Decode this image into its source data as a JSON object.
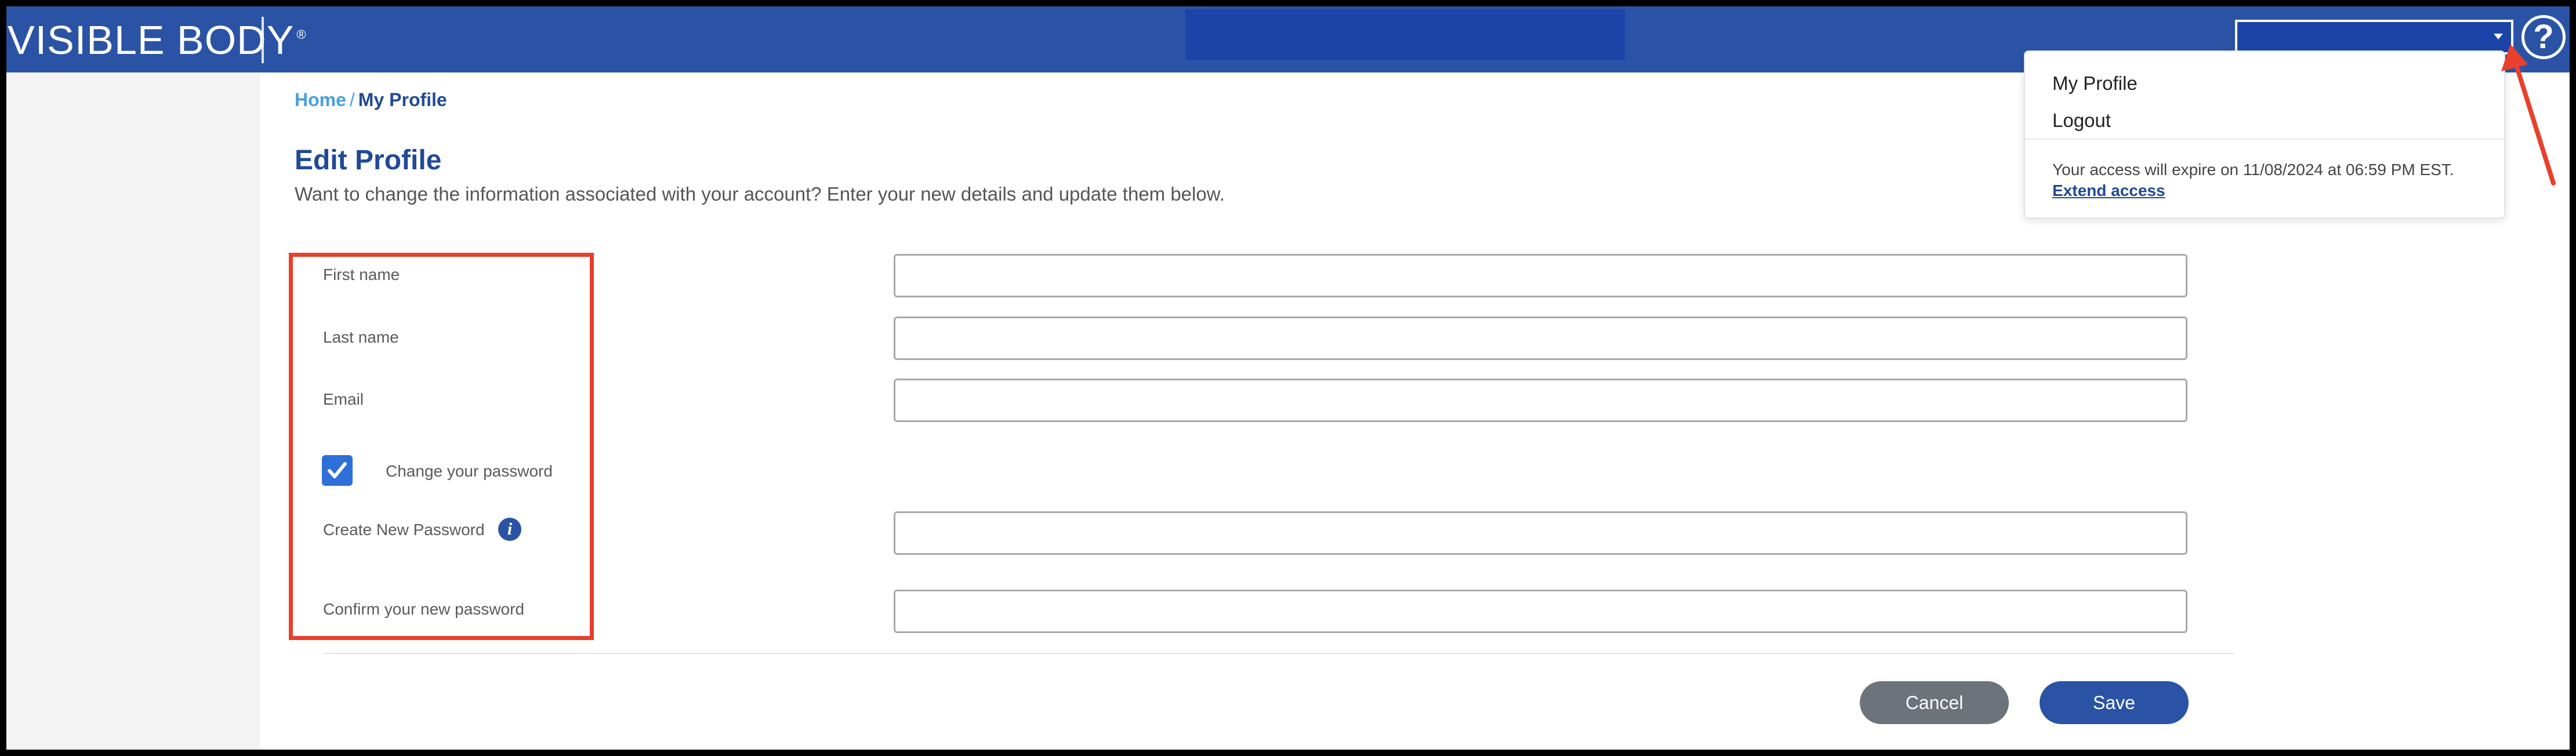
{
  "header": {
    "logo_text": "VISIBLE BODY",
    "logo_registered": "®",
    "help_symbol": "?"
  },
  "breadcrumb": {
    "home": "Home",
    "separator": "/",
    "current": "My Profile"
  },
  "page": {
    "title": "Edit Profile",
    "subtitle": "Want to change the information associated with your account? Enter your new details and update them below."
  },
  "form": {
    "first_name_label": "First name",
    "last_name_label": "Last name",
    "email_label": "Email",
    "change_password_label": "Change your password",
    "change_password_checked": true,
    "new_password_label": "Create New Password",
    "confirm_password_label": "Confirm your new password",
    "info_symbol": "i"
  },
  "buttons": {
    "cancel": "Cancel",
    "save": "Save"
  },
  "dropdown": {
    "my_profile": "My Profile",
    "logout": "Logout",
    "expire_text": "Your access will expire on 11/08/2024 at 06:59 PM EST.",
    "extend_link": "Extend access"
  },
  "colors": {
    "brand_blue": "#2a53a6",
    "annotation_red": "#e8402b"
  }
}
